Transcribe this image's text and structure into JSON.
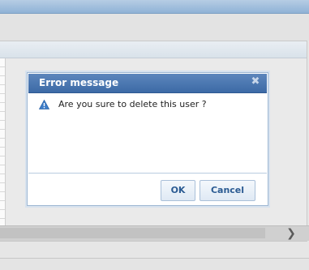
{
  "dialog": {
    "title": "Error message",
    "close_glyph": "✖",
    "message": "Are you sure to delete this user ?",
    "icon": "warning-icon",
    "buttons": {
      "ok": "OK",
      "cancel": "Cancel"
    }
  },
  "scrollbar": {
    "arrow_glyph": "❯"
  },
  "colors": {
    "titlebar": "#3c6aa6",
    "button_text": "#2a5a92",
    "warning_icon": "#3d7dc9"
  }
}
